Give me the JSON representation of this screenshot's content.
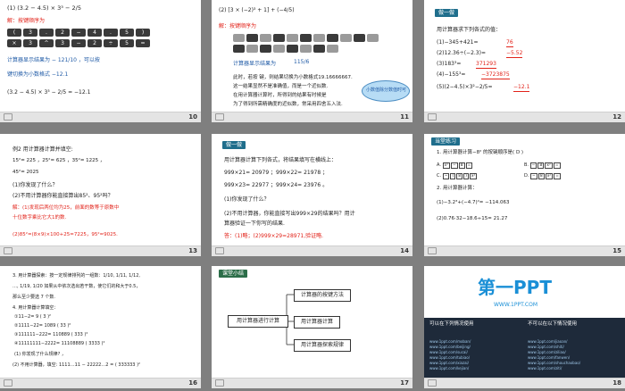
{
  "slides": [
    {
      "page": "10"
    },
    {
      "page": "11"
    },
    {
      "page": "12"
    },
    {
      "page": "13"
    },
    {
      "page": "14"
    },
    {
      "page": "15"
    },
    {
      "page": "16"
    },
    {
      "page": "17"
    },
    {
      "page": "18"
    }
  ],
  "s10": {
    "line1": "(1) (3.2 − 4.5) × 3³ − 2/5",
    "jie": "解：按键顺序为",
    "keys1": [
      "(",
      "3",
      ".",
      "2",
      "−",
      "4",
      ".",
      "5",
      ")"
    ],
    "keys2": [
      "×",
      "3",
      "^",
      "3",
      "−",
      "2",
      "÷",
      "5",
      "="
    ],
    "display_text": "计算器显示结果为 − 121/10 ，可以按",
    "switch_text": "键切换为小数格式 −12.1",
    "result": "(3.2 − 4.5) × 3³ − 2/5 = −12.1"
  },
  "s11": {
    "line1": "(2) [3 × (−2)³ + 1] + (−4/5)",
    "jie": "解：按键顺序为",
    "display_text": "计算器显示结果为",
    "frac": "115/6",
    "p1": "此时，若按     键，则结果切换为小数格式19.16666667.",
    "p2": "这一结果显然不是准确值，而是一个近似数.",
    "p3": "在用计算器计算时，所得到的结果有时候是",
    "p4": "为了得到所需精确度的近似数，常采用四舍五入法.",
    "bubble": "小数值除分数值时可"
  },
  "s12": {
    "tag": "做一做",
    "intro": "用计算器求下列各式的值：",
    "items": [
      {
        "q": "(1)−345+421=",
        "a": "76"
      },
      {
        "q": "(2)12.36÷(−2.3)=",
        "a": "−5.52"
      },
      {
        "q": "(3)183³=",
        "a": "371293"
      },
      {
        "q": "(4)−155³=",
        "a": "−3723875"
      },
      {
        "q": "(5)(2−4.5)×3²−2/5=",
        "a": "−12.1"
      }
    ]
  },
  "s13": {
    "l1": "例2  用计算器计算并填空:",
    "l2": "15²=     225    ，25²=     625    ，35²=    1225   ，",
    "l3": "45²=    2025",
    "q1": "(1)你发现了什么？",
    "q2": "(2)不用计算器你能直接算出85²、95²吗？",
    "a1": "解：(1)发现后两位均为25，前面的数等于原数中",
    "a2": "十位数字乘比它大1的数.",
    "a3": "(2)85²=(8×9)×100+25=7225，95²=9025."
  },
  "s14": {
    "tag": "做一做",
    "intro": "用计算器计算下列各式，将结果填写在横线上：",
    "r1": "999×21=    20979    ；999×22=    21978    ；",
    "r2": "999×23=    22977    ；999×24=    23976    。",
    "q1": "(1)你发现了什么？",
    "q2": "(2)不用计算器，你能直接写出999×29的结果吗？用计",
    "q3": "算器验证一下你写的结果.",
    "ans": "答：(1)略；(2)999×29=28971,验证略."
  },
  "s15": {
    "tag": "当堂练习",
    "l1": "1. 用计算器计算−8² 的按键顺序是(   D   )",
    "opts": [
      "A.",
      "B.",
      "C.",
      "D."
    ],
    "l2": "2. 用计算器计算：",
    "l3": "(1)−3.2³+(−4.7)²=   −114.063",
    "l4": "(2)0.76·32−18.6÷15=     21.27"
  },
  "s16": {
    "l1": "3. 用计算器探索：按一定规律排列的一组数：1/10, 1/11, 1/12,",
    "l2": "…, 1/19, 1/20 如果从中依次选出若干数，使它们的和大于0.5，",
    "l3": "那么至少要选    7    个数.",
    "l4": "4. 用计算器计算填空：",
    "l5": "①11−2=    9    (   3   )²",
    "l6": "②1111−22=    1089    (   33   )²",
    "l7": "③111111−222=  110889  (   333   )²",
    "l8": "④11111111−2222=  11108889  (   3333   )²",
    "l9": "(1) 你发现了什么规律?         ，",
    "l10": "(2) 不用计算器，填空: 1111…11 − 22222…2 = (   333333   )²"
  },
  "s17": {
    "tag": "课堂小结",
    "center": "用计算器进行计算",
    "b1": "计算器的按键方法",
    "b2": "用计算器计算",
    "b3": "用计算器探索规律"
  },
  "s18": {
    "logo": "第一PPT",
    "url": "WWW.1PPT.COM",
    "left_title": "可以在下列情况使用",
    "right_title": "不可以在以下情况使用",
    "links_left": [
      "www.1ppt.com/moban/",
      "www.1ppt.com/beijing/",
      "www.1ppt.com/sucai/",
      "www.1ppt.com/tubiao/",
      "www.1ppt.com/xiazai/",
      "www.1ppt.com/kejian/"
    ],
    "links_right": [
      "www.1ppt.com/jiaoan/",
      "www.1ppt.com/shiti/",
      "www.1ppt.com/ziliao/",
      "www.1ppt.com/fanwen/",
      "www.1ppt.com/shouchaobao/",
      "www.1ppt.com/ziti/"
    ]
  }
}
